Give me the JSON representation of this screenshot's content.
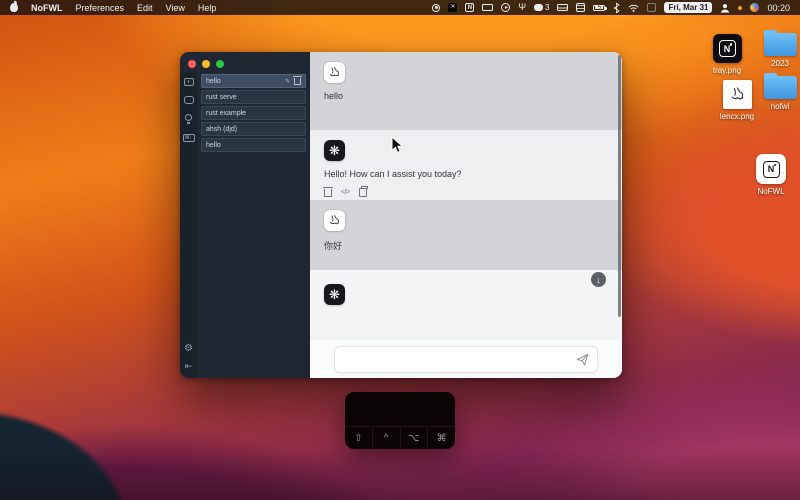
{
  "menu_bar": {
    "app_name": "NoFWL",
    "items": [
      "Preferences",
      "Edit",
      "View",
      "Help"
    ],
    "status": {
      "wechat_badge": "3",
      "date": "Fri, Mar 31",
      "time": "00:20"
    }
  },
  "window": {
    "sidebar": {
      "conversations": [
        {
          "title": "hello",
          "selected": true
        },
        {
          "title": "rust serve"
        },
        {
          "title": "rust example"
        },
        {
          "title": "ahsh (djd)"
        },
        {
          "title": "hello"
        }
      ]
    },
    "chat": {
      "messages": {
        "m0": {
          "role": "user",
          "text": "hello"
        },
        "m1": {
          "role": "assistant",
          "text": "Hello! How can I assist you today?"
        },
        "m2": {
          "role": "user",
          "text": "你好"
        },
        "m3": {
          "role": "assistant",
          "text": ""
        }
      },
      "input_value": ""
    }
  },
  "desktop_icons": {
    "tray": {
      "label": "tray.png"
    },
    "folder2023": {
      "label": "2023"
    },
    "lencx": {
      "label": "lencx.png"
    },
    "nofwl_folder": {
      "label": "nofwl"
    },
    "app": {
      "label": "NoFWL"
    }
  },
  "overlay": {
    "keys": [
      "⇧",
      "^",
      "⌥",
      "⌘"
    ]
  },
  "glyphs": {
    "openai": "❋",
    "plus": "+",
    "markdown": "M↓",
    "gear": "⚙",
    "collapse": "⇤",
    "pencil": "✎",
    "code": "</>",
    "scroll_down": "↓",
    "play": "▸",
    "n_badge": "N",
    "x_badge": "✕",
    "usb": "Ψ",
    "bolt": "ϟ",
    "n_letter": "N"
  },
  "colors": {
    "folder_blue": "#4aa3e8",
    "selected_item": "#3e4d63",
    "user_band": "#d2d4d7",
    "assistant_band": "#edeff1",
    "sidebar_bg": "#1e2732"
  }
}
